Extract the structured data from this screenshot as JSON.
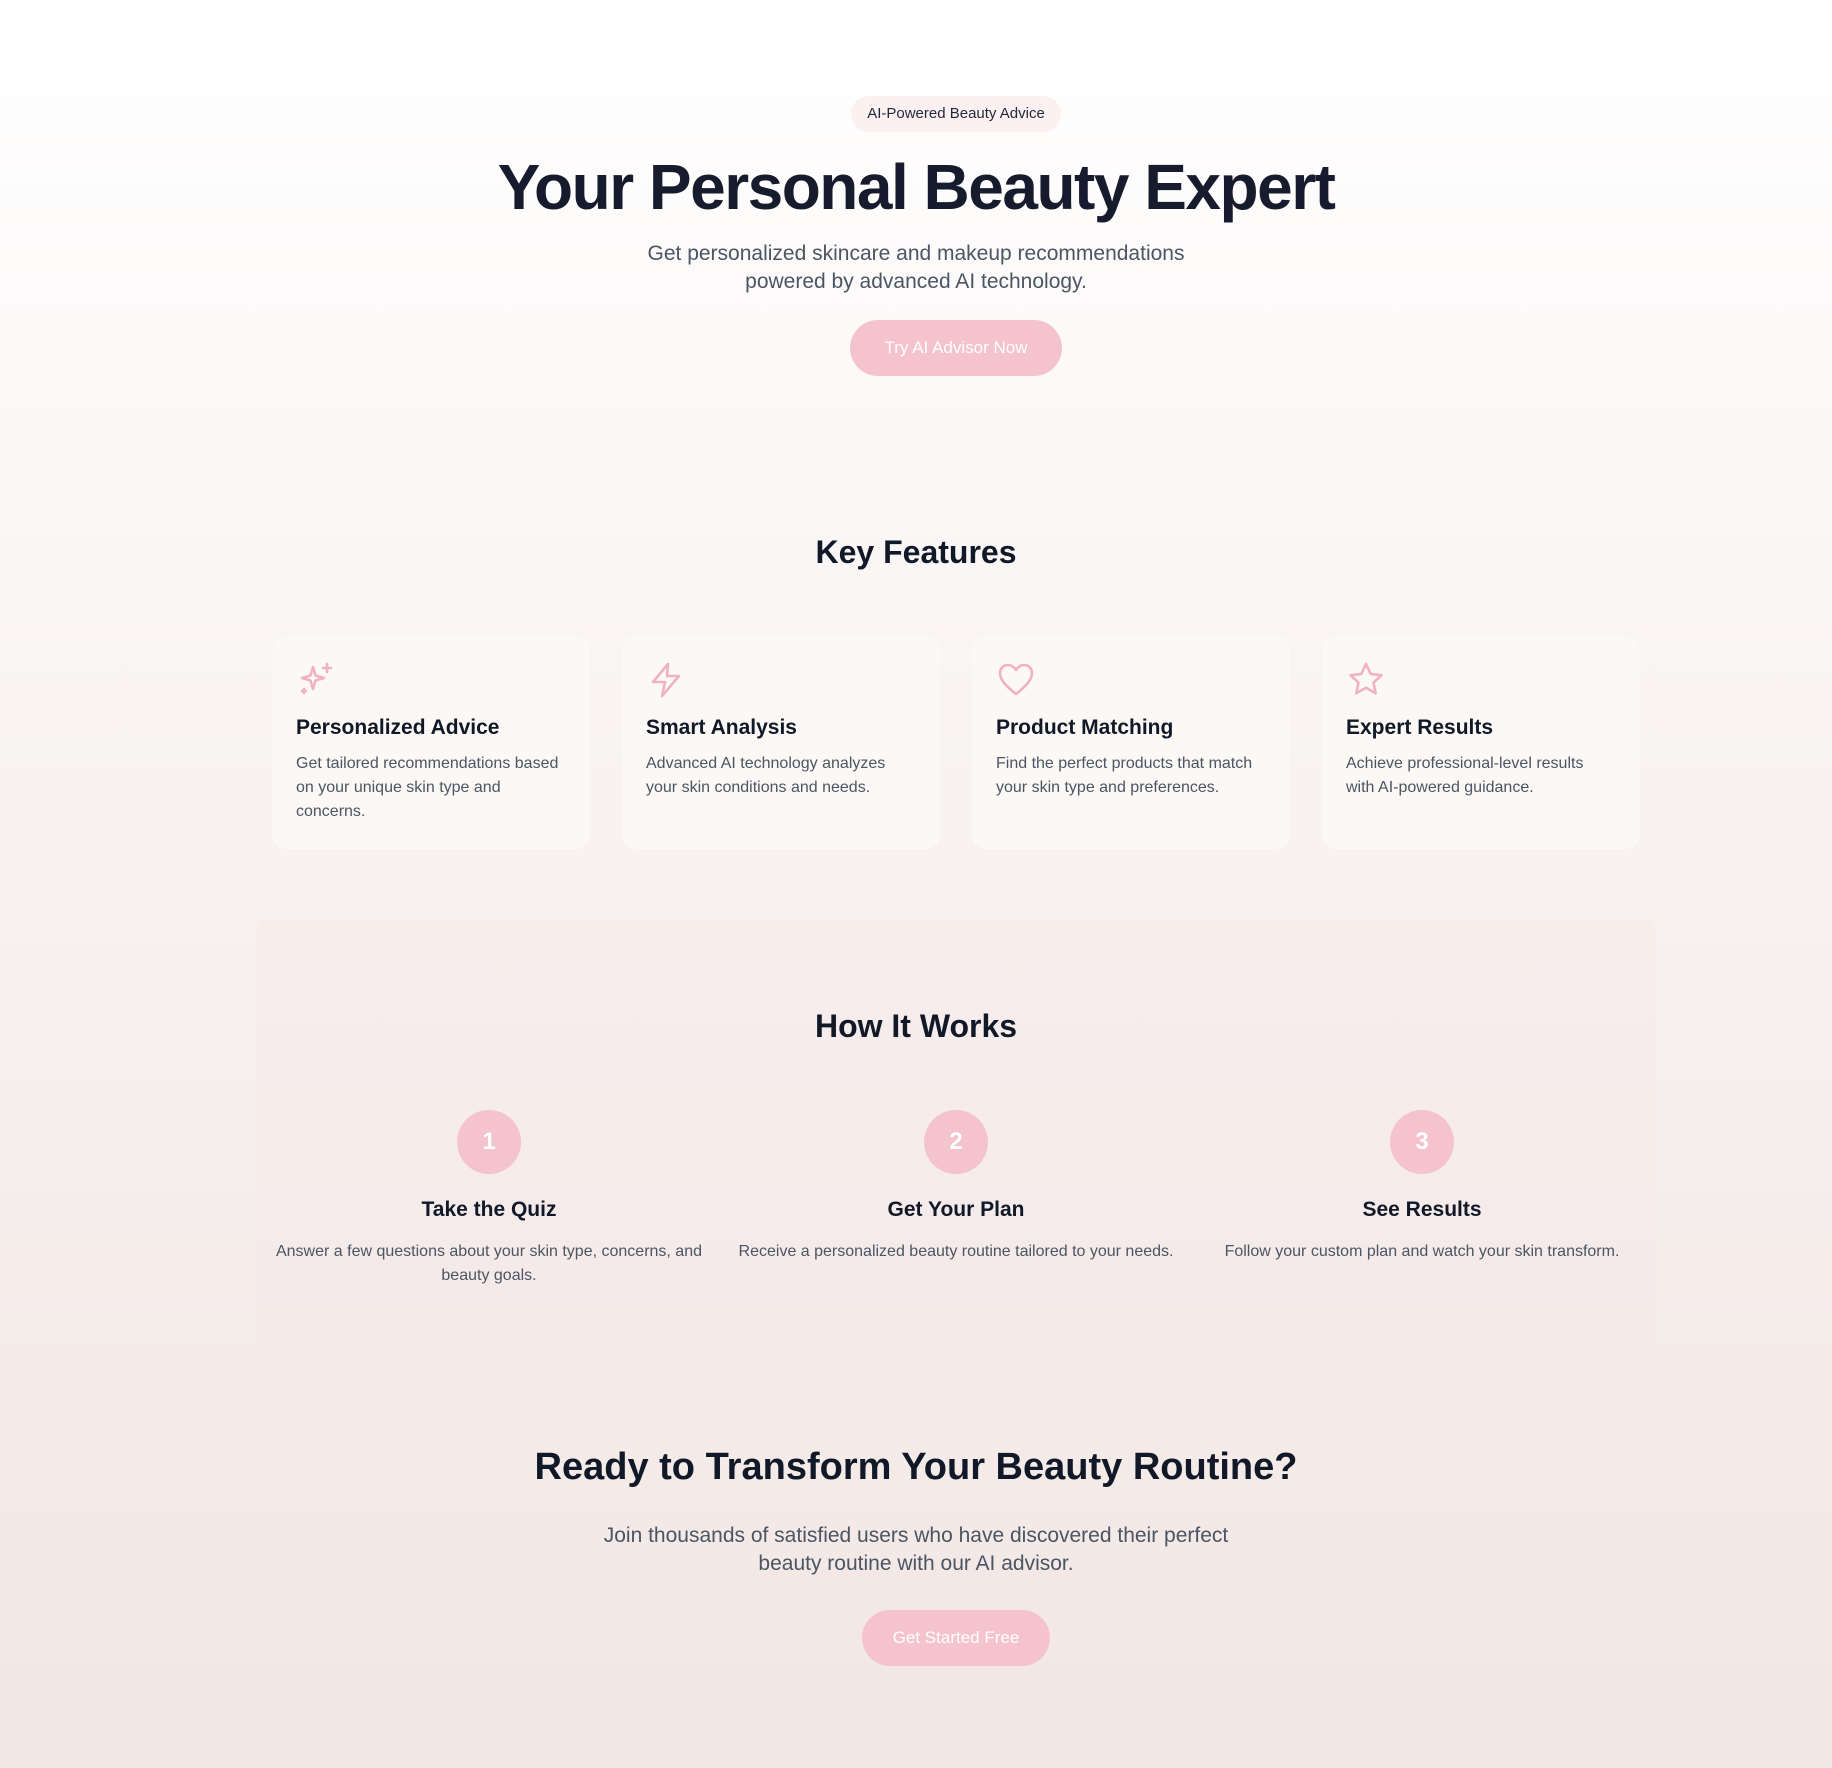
{
  "hero": {
    "badge": "AI-Powered Beauty Advice",
    "title": "Your Personal Beauty Expert",
    "subtitle": "Get personalized skincare and makeup recommendations powered by advanced AI technology.",
    "button": "Try AI Advisor Now"
  },
  "features": {
    "title": "Key Features",
    "items": [
      {
        "icon": "sparkles-icon",
        "title": "Personalized Advice",
        "desc": "Get tailored recommendations based on your unique skin type and concerns."
      },
      {
        "icon": "lightning-icon",
        "title": "Smart Analysis",
        "desc": "Advanced AI technology analyzes your skin conditions and needs."
      },
      {
        "icon": "heart-icon",
        "title": "Product Matching",
        "desc": "Find the perfect products that match your skin type and preferences."
      },
      {
        "icon": "star-icon",
        "title": "Expert Results",
        "desc": "Achieve professional-level results with AI-powered guidance."
      }
    ]
  },
  "how": {
    "title": "How It Works",
    "steps": [
      {
        "number": "1",
        "title": "Take the Quiz",
        "desc": "Answer a few questions about your skin type, concerns, and beauty goals."
      },
      {
        "number": "2",
        "title": "Get Your Plan",
        "desc": "Receive a personalized beauty routine tailored to your needs."
      },
      {
        "number": "3",
        "title": "See Results",
        "desc": "Follow your custom plan and watch your skin transform."
      }
    ]
  },
  "cta": {
    "title": "Ready to Transform Your Beauty Routine?",
    "subtitle": "Join thousands of satisfied users who have discovered their perfect beauty routine with our AI advisor.",
    "button": "Get Started Free"
  },
  "colors": {
    "accent": "#f4c3ce",
    "icon_stroke": "#f0b2c1",
    "heading": "#111827",
    "body": "#4b5563"
  }
}
